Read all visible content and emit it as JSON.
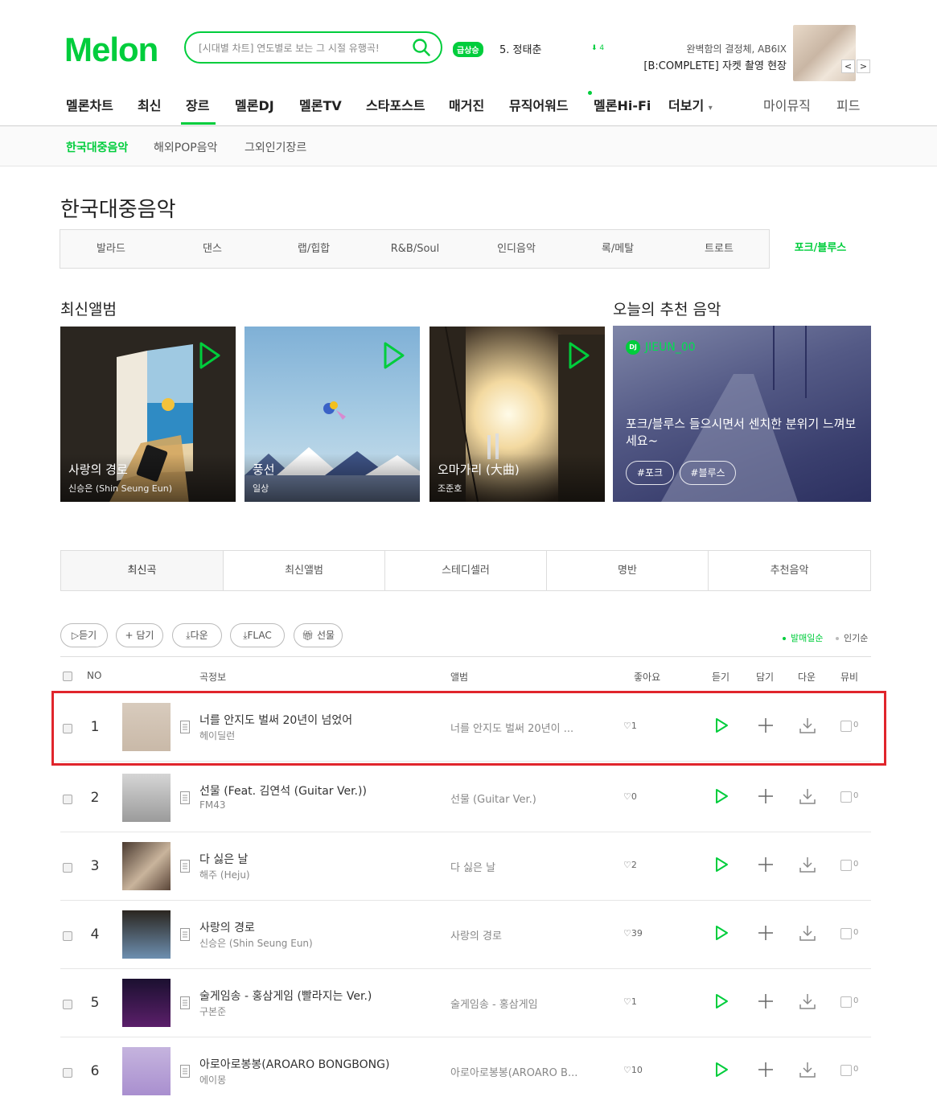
{
  "header": {
    "logo": "Melon",
    "search_placeholder": "[시대별 차트] 연도별로 보는 그 시절 유행곡!",
    "rank_badge": "급상승",
    "rank_text": "5. 정태춘",
    "rank_change": "4",
    "promo_line1": "완벽함의 결정체, AB6IX",
    "promo_line2": "[B:COMPLETE] 자켓 촬영 현장",
    "prev": "<",
    "next": ">"
  },
  "gnb": {
    "items": [
      "멜론차트",
      "최신",
      "장르",
      "멜론DJ",
      "멜론TV",
      "스타포스트",
      "매거진",
      "뮤직어워드",
      "멜론Hi-Fi",
      "더보기"
    ],
    "more_arrow": "▾",
    "right": [
      "마이뮤직",
      "피드"
    ],
    "active": "장르"
  },
  "subnav": [
    "한국대중음악",
    "해외POP음악",
    "그외인기장르"
  ],
  "page_title": "한국대중음악",
  "genre_tabs": [
    "발라드",
    "댄스",
    "랩/힙합",
    "R&B/Soul",
    "인디음악",
    "록/메탈",
    "트로트",
    "포크/블루스"
  ],
  "latest_albums": {
    "title": "최신앨범",
    "items": [
      {
        "title": "사랑의 경로",
        "artist": "신승은 (Shin Seung Eun)"
      },
      {
        "title": "풍선",
        "artist": "일상"
      },
      {
        "title": "오마가리 (大曲)",
        "artist": "조준호"
      }
    ]
  },
  "recommend": {
    "title": "오늘의 추천 음악",
    "dj_badge": "DJ",
    "dj_name": "JIEUN_00",
    "text": "포크/블루스 들으시면서 센치한 분위기 느껴보세요~",
    "tags": [
      "#포크",
      "#블루스"
    ]
  },
  "song_tabs": [
    "최신곡",
    "최신앨범",
    "스테디셀러",
    "명반",
    "추천음악"
  ],
  "actions": [
    "듣기",
    "담기",
    "다운",
    "FLAC",
    "선물"
  ],
  "sort": [
    "발매일순",
    "인기순"
  ],
  "table_headers": {
    "no": "NO",
    "song": "곡정보",
    "album": "앨범",
    "like": "좋아요",
    "play": "듣기",
    "add": "담기",
    "down": "다운",
    "mv": "뮤비"
  },
  "songs": [
    {
      "no": "1",
      "title": "너를 안지도 벌써 20년이 넘었어",
      "artist": "헤이딜런",
      "album": "너를 안지도 벌써 20년이 ...",
      "likes": "♡1",
      "mv": "0"
    },
    {
      "no": "2",
      "title": "선물 (Feat. 김연석 (Guitar Ver.))",
      "artist": "FM43",
      "album": "선물 (Guitar Ver.)",
      "likes": "♡0",
      "mv": "0"
    },
    {
      "no": "3",
      "title": "다 싫은 날",
      "artist": "해주 (Heju)",
      "album": "다 싫은 날",
      "likes": "♡2",
      "mv": "0"
    },
    {
      "no": "4",
      "title": "사랑의 경로",
      "artist": "신승은 (Shin Seung Eun)",
      "album": "사랑의 경로",
      "likes": "♡39",
      "mv": "0"
    },
    {
      "no": "5",
      "title": "술게임송 - 홍삼게임 (빨라지는 Ver.)",
      "artist": "구본준",
      "album": "술게임송 - 홍삼게임",
      "likes": "♡1",
      "mv": "0"
    },
    {
      "no": "6",
      "title": "아로아로봉봉(AROARO BONGBONG)",
      "artist": "에이몽",
      "album": "아로아로봉봉(AROARO B...",
      "likes": "♡10",
      "mv": "0"
    }
  ],
  "colors": {
    "brand": "#00cd3c",
    "highlight": "#e0252c"
  }
}
